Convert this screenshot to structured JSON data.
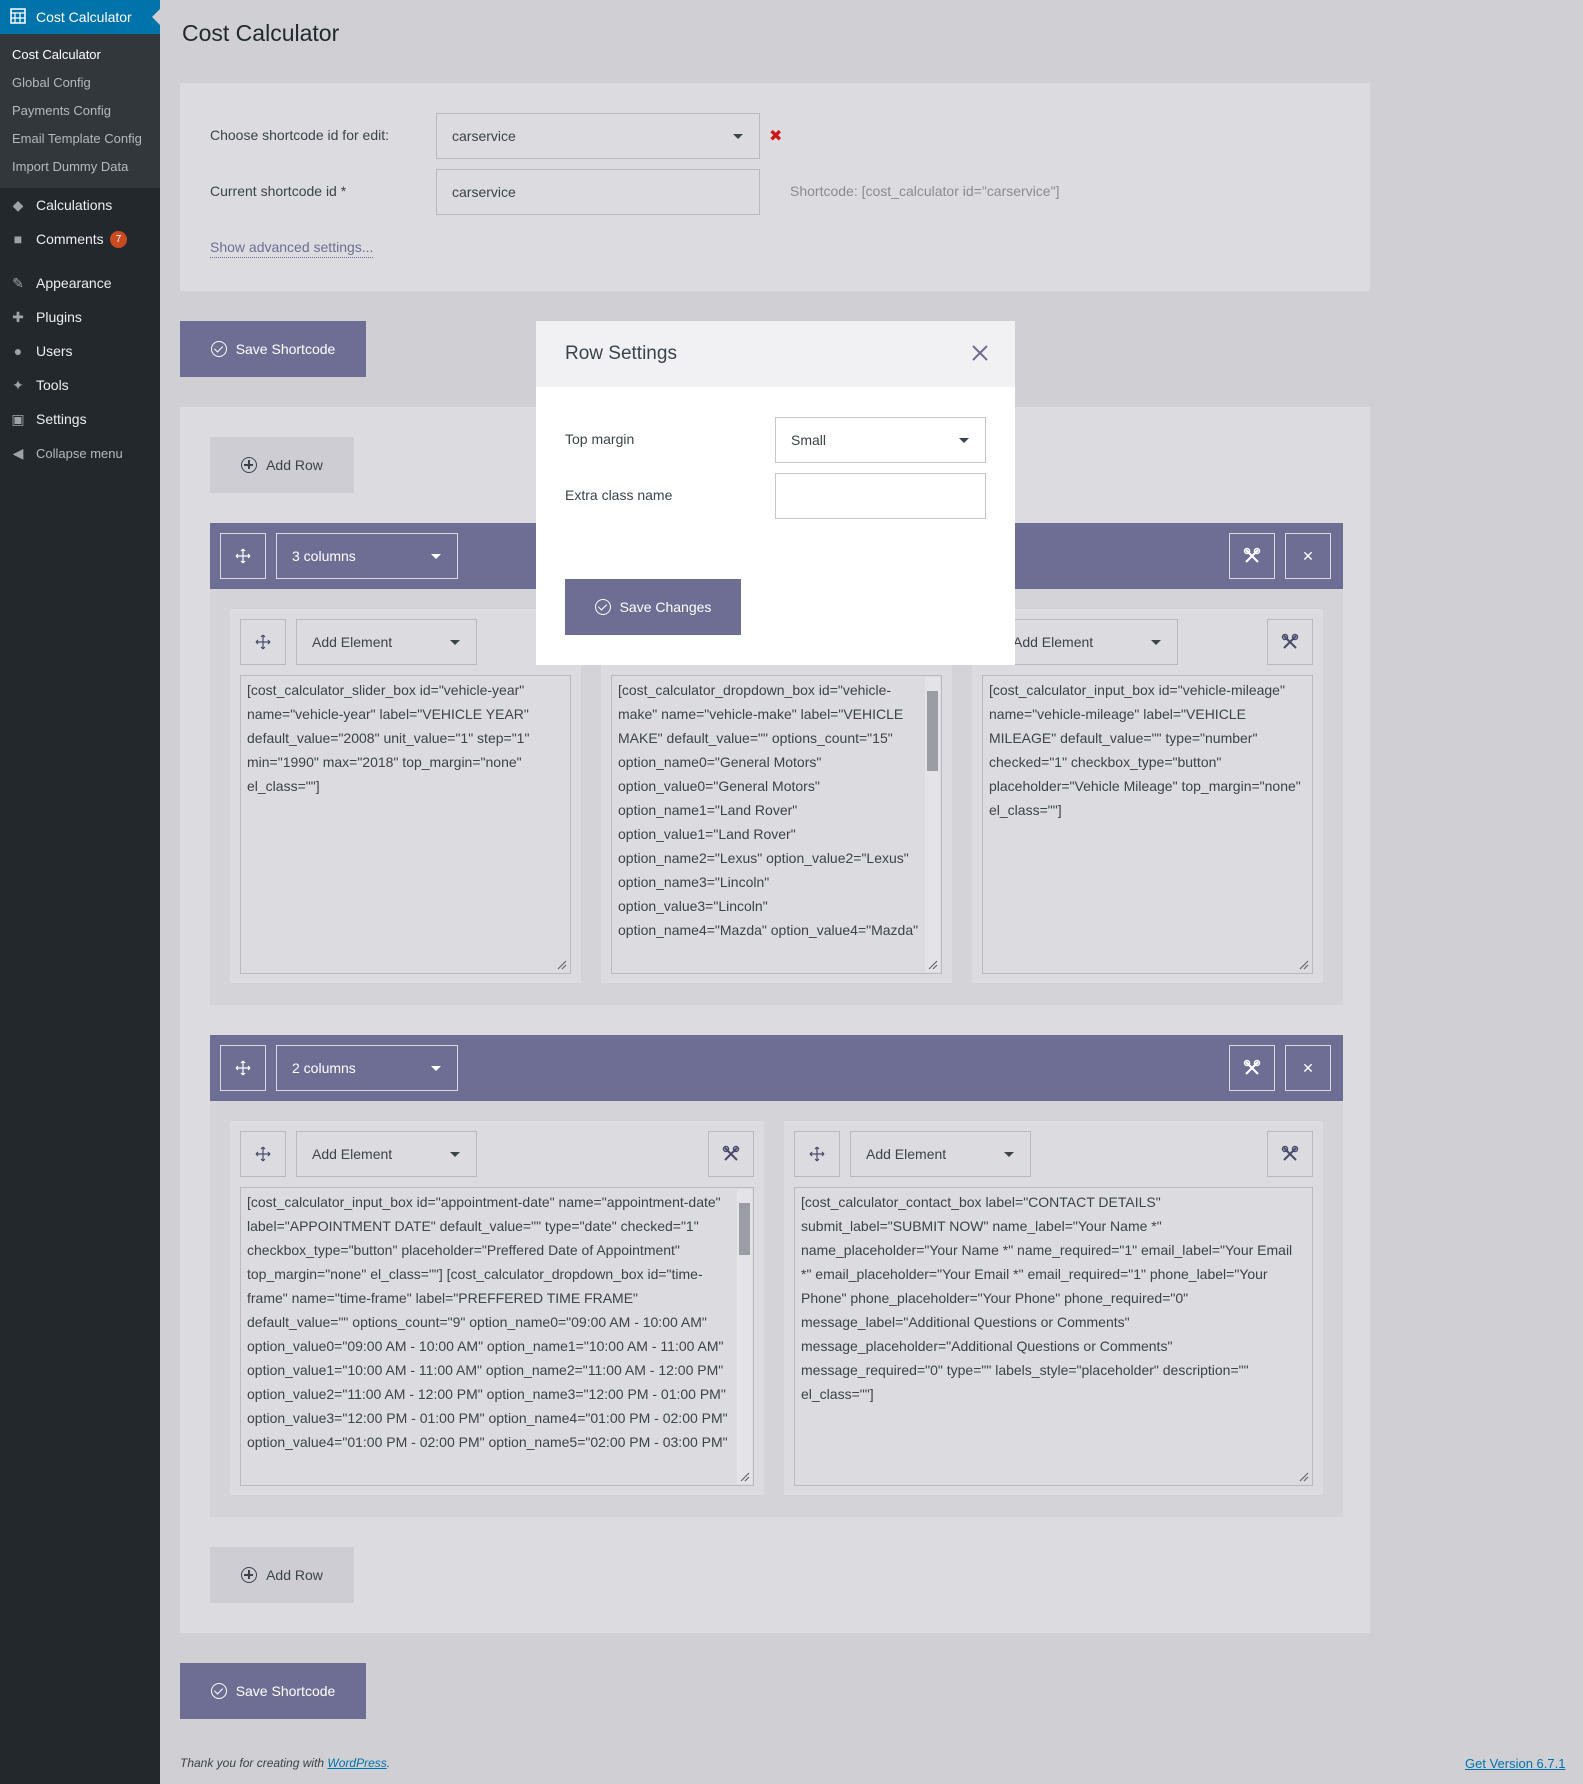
{
  "sidebar": {
    "plugin_title": "Cost Calculator",
    "sub_items": [
      "Cost Calculator",
      "Global Config",
      "Payments Config",
      "Email Template Config",
      "Import Dummy Data"
    ],
    "items": [
      {
        "label": "Calculations",
        "icon": "tag-icon"
      },
      {
        "label": "Comments",
        "icon": "comment-icon",
        "badge": "7"
      },
      {
        "label": "Appearance",
        "icon": "brush-icon"
      },
      {
        "label": "Plugins",
        "icon": "plugin-icon"
      },
      {
        "label": "Users",
        "icon": "user-icon"
      },
      {
        "label": "Tools",
        "icon": "wrench-icon"
      },
      {
        "label": "Settings",
        "icon": "settings-icon"
      },
      {
        "label": "Collapse menu",
        "icon": "collapse-icon"
      }
    ]
  },
  "page": {
    "title": "Cost Calculator",
    "choose_label": "Choose shortcode id for edit:",
    "choose_value": "carservice",
    "current_label": "Current shortcode id *",
    "current_value": "carservice",
    "shortcode_text": "Shortcode: [cost_calculator id=\"carservice\"]",
    "advanced_link": "Show advanced settings...",
    "save_shortcode": "Save Shortcode",
    "add_row": "Add Row",
    "add_element": "Add Element"
  },
  "rows": [
    {
      "columns_label": "3 columns",
      "cells": [
        "[cost_calculator_slider_box id=\"vehicle-year\" name=\"vehicle-year\" label=\"VEHICLE YEAR\" default_value=\"2008\" unit_value=\"1\" step=\"1\" min=\"1990\" max=\"2018\" top_margin=\"none\" el_class=\"\"]",
        "[cost_calculator_dropdown_box id=\"vehicle-make\" name=\"vehicle-make\" label=\"VEHICLE MAKE\" default_value=\"\" options_count=\"15\" option_name0=\"General Motors\" option_value0=\"General Motors\" option_name1=\"Land Rover\" option_value1=\"Land Rover\" option_name2=\"Lexus\" option_value2=\"Lexus\" option_name3=\"Lincoln\" option_value3=\"Lincoln\" option_name4=\"Mazda\" option_value4=\"Mazda\"",
        "[cost_calculator_input_box id=\"vehicle-mileage\" name=\"vehicle-mileage\" label=\"VEHICLE MILEAGE\" default_value=\"\" type=\"number\" checked=\"1\" checkbox_type=\"button\" placeholder=\"Vehicle Mileage\" top_margin=\"none\" el_class=\"\"]"
      ]
    },
    {
      "columns_label": "2 columns",
      "cells": [
        "[cost_calculator_input_box id=\"appointment-date\" name=\"appointment-date\" label=\"APPOINTMENT DATE\" default_value=\"\" type=\"date\" checked=\"1\" checkbox_type=\"button\" placeholder=\"Preffered Date of Appointment\" top_margin=\"none\" el_class=\"\"] [cost_calculator_dropdown_box id=\"time-frame\" name=\"time-frame\" label=\"PREFFERED TIME FRAME\" default_value=\"\" options_count=\"9\" option_name0=\"09:00 AM - 10:00 AM\" option_value0=\"09:00 AM - 10:00 AM\" option_name1=\"10:00 AM - 11:00 AM\" option_value1=\"10:00 AM - 11:00 AM\" option_name2=\"11:00 AM - 12:00 PM\" option_value2=\"11:00 AM - 12:00 PM\" option_name3=\"12:00 PM - 01:00 PM\" option_value3=\"12:00 PM - 01:00 PM\" option_name4=\"01:00 PM - 02:00 PM\" option_value4=\"01:00 PM - 02:00 PM\" option_name5=\"02:00 PM - 03:00 PM\"",
        "[cost_calculator_contact_box label=\"CONTACT DETAILS\" submit_label=\"SUBMIT NOW\" name_label=\"Your Name *\" name_placeholder=\"Your Name *\" name_required=\"1\" email_label=\"Your Email *\" email_placeholder=\"Your Email *\" email_required=\"1\" phone_label=\"Your Phone\" phone_placeholder=\"Your Phone\" phone_required=\"0\" message_label=\"Additional Questions or Comments\" message_placeholder=\"Additional Questions or Comments\" message_required=\"0\" type=\"\" labels_style=\"placeholder\" description=\"\" el_class=\"\"]"
      ]
    }
  ],
  "modal": {
    "title": "Row Settings",
    "top_margin_label": "Top margin",
    "top_margin_value": "Small",
    "extra_class_label": "Extra class name",
    "extra_class_value": "",
    "save_label": "Save Changes"
  },
  "footer": {
    "thanks_prefix": "Thank you for creating with ",
    "wp_link": "WordPress",
    "thanks_suffix": ".",
    "version_link": "Get Version 6.7.1"
  },
  "colors": {
    "sidebar_bg": "#23282d",
    "accent": "#0073aa",
    "purple": "#6e6e94",
    "delete_x": "#cc1818"
  }
}
